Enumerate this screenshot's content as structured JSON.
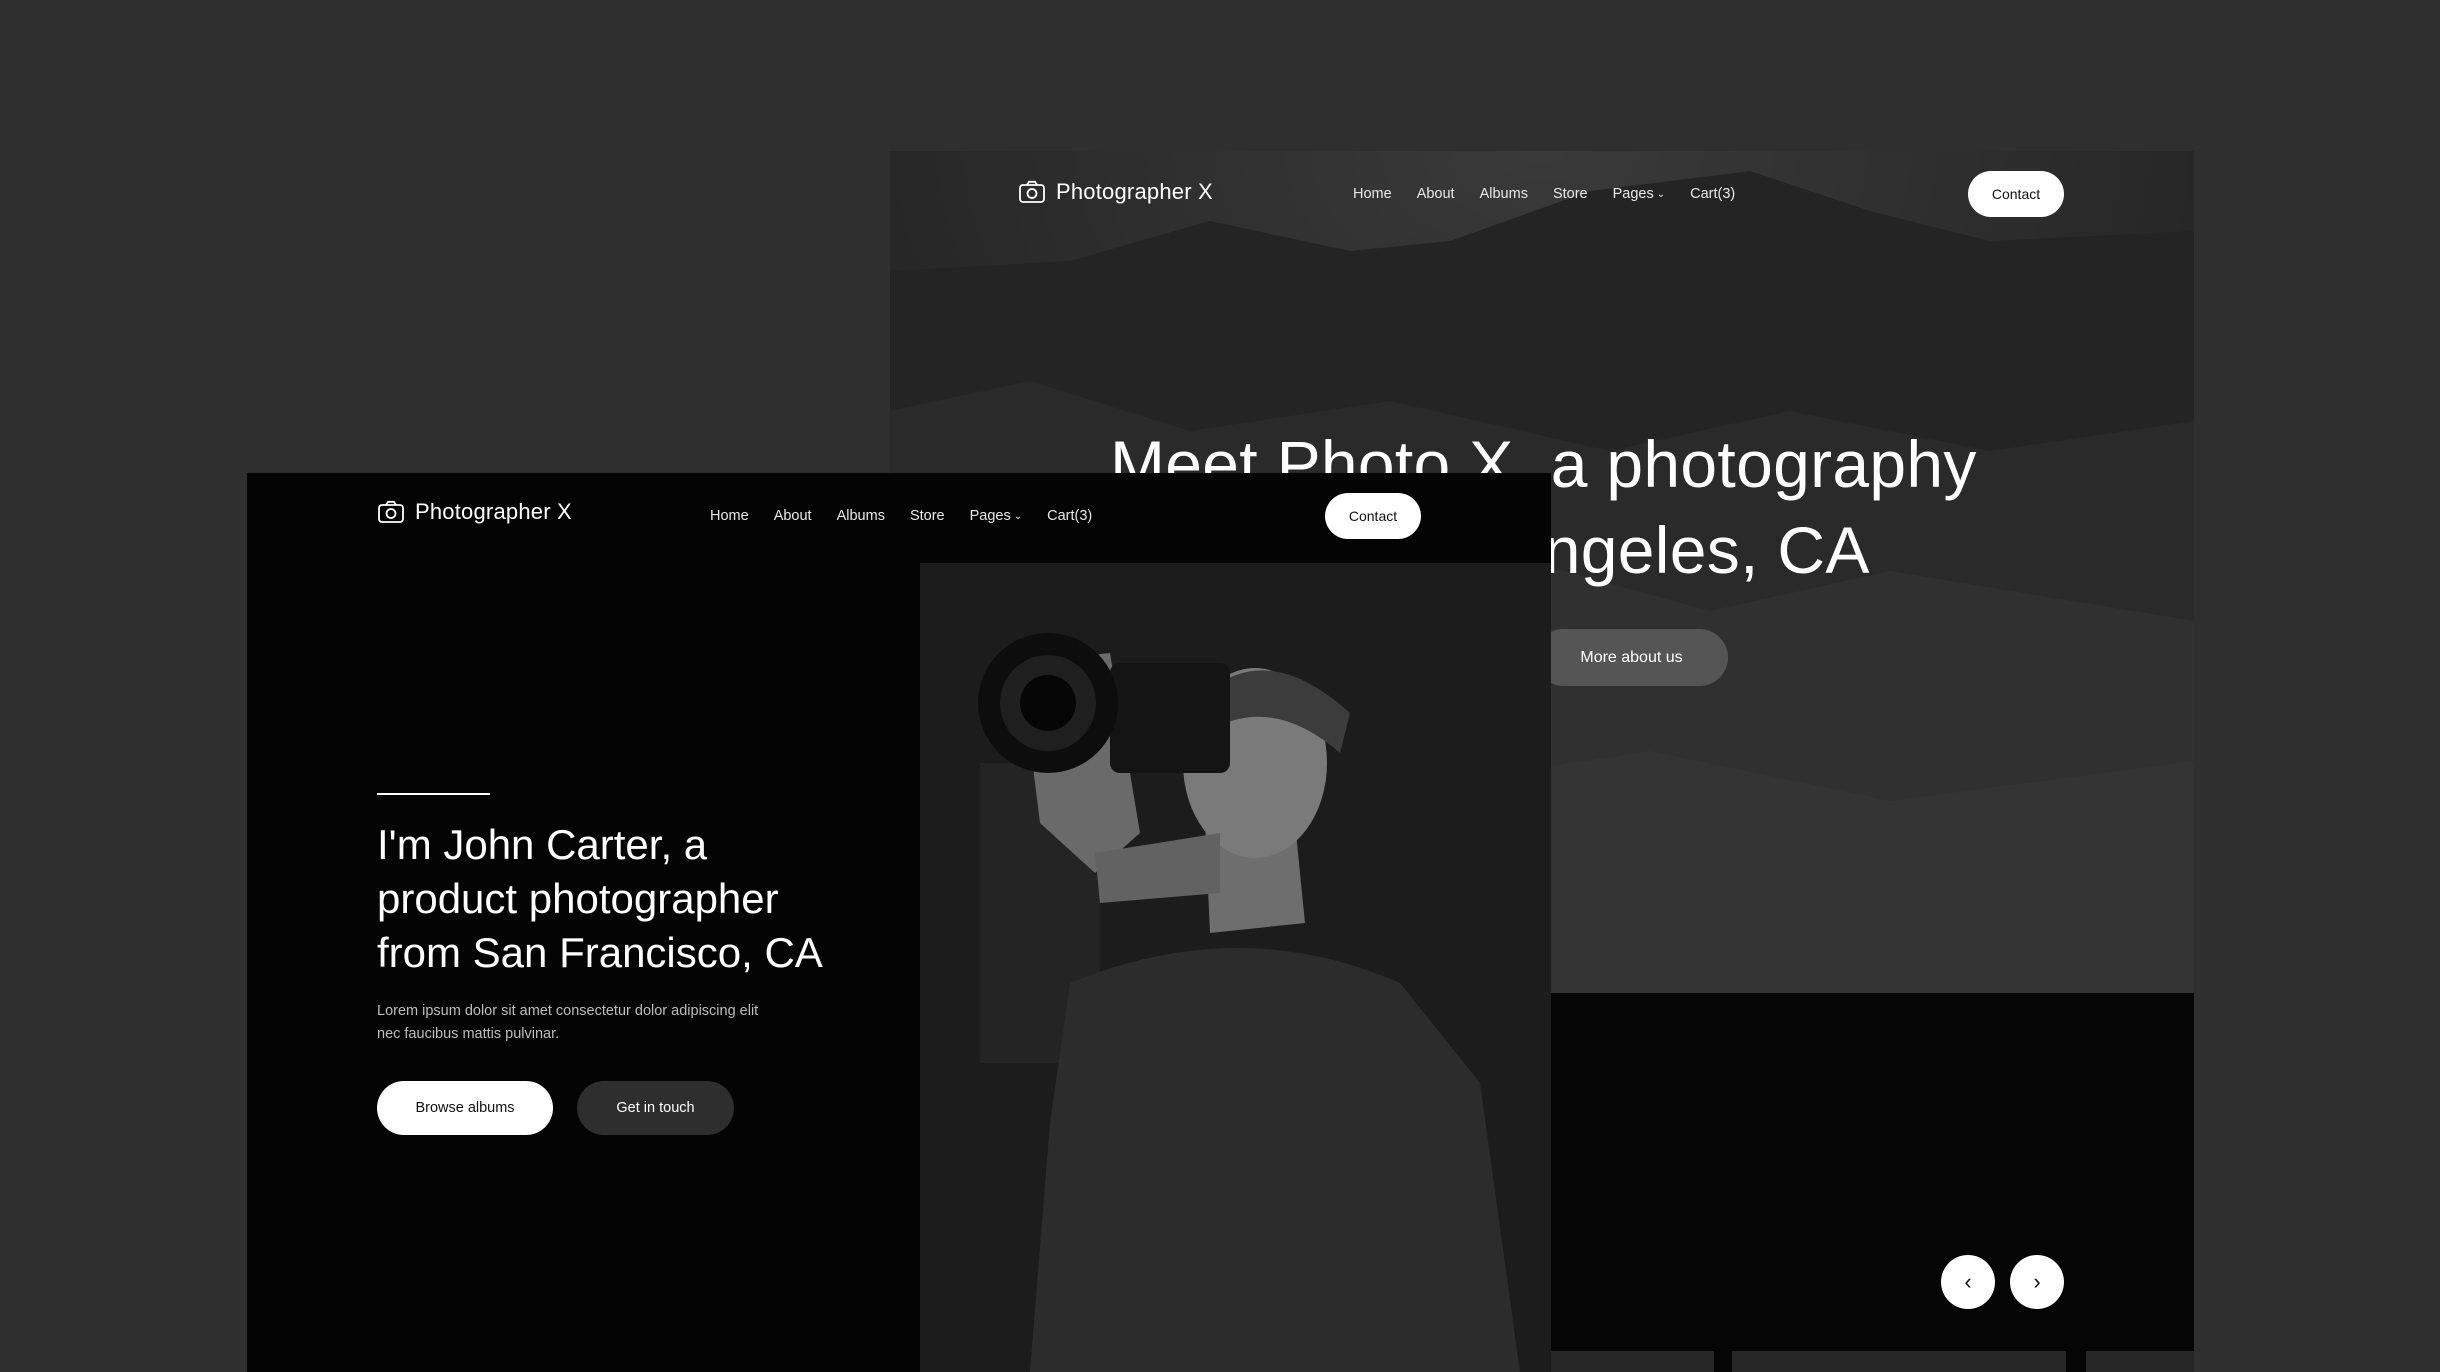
{
  "back_page": {
    "logo_text": "Photographer X",
    "nav": [
      "Home",
      "About",
      "Albums",
      "Store",
      "Pages",
      "Cart(3)"
    ],
    "contact_label": "Contact",
    "hero_title_line1": "Meet Photo X, a photography",
    "hero_title_line2": "studio in Los Angeles, CA",
    "more_label": "More about us",
    "prev_icon": "‹",
    "next_icon": "›"
  },
  "front_page": {
    "logo_text": "Photographer X",
    "nav": [
      "Home",
      "About",
      "Albums",
      "Store",
      "Pages",
      "Cart(3)"
    ],
    "contact_label": "Contact",
    "hero_title": "I'm John Carter, a product photographer from San Francisco, CA",
    "hero_desc": "Lorem ipsum dolor sit amet consectetur dolor adipiscing elit nec faucibus mattis pulvinar.",
    "browse_label": "Browse albums",
    "touch_label": "Get in touch"
  },
  "icons": {
    "logo": "camera-icon",
    "dropdown": "chevron-down-icon",
    "prev": "chevron-left-icon",
    "next": "chevron-right-icon"
  },
  "colors": {
    "canvas": "#2f2f2f",
    "page_bg": "#050505",
    "accent": "#ffffff"
  }
}
